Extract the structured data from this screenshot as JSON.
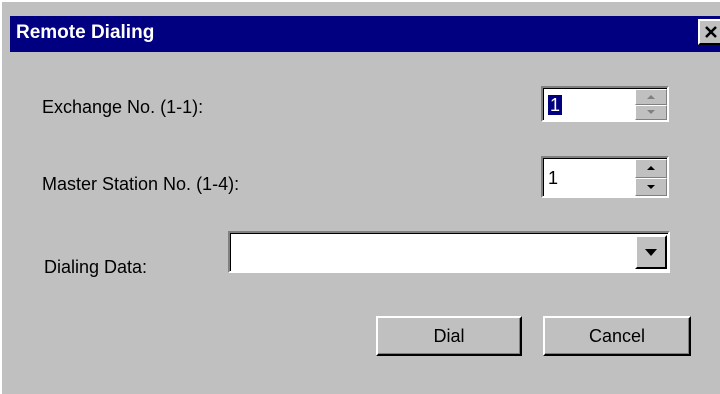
{
  "window": {
    "title": "Remote Dialing",
    "close_icon": "close-icon"
  },
  "fields": {
    "exchange": {
      "label": "Exchange No. (1-1):",
      "value": "1"
    },
    "master_station": {
      "label": "Master Station No. (1-4):",
      "value": "1"
    },
    "dialing_data": {
      "label": "Dialing Data:",
      "value": ""
    }
  },
  "buttons": {
    "dial": "Dial",
    "cancel": "Cancel"
  },
  "colors": {
    "title_bar": "#000080",
    "dialog_bg": "#c0c0c0",
    "selection": "#000080"
  }
}
